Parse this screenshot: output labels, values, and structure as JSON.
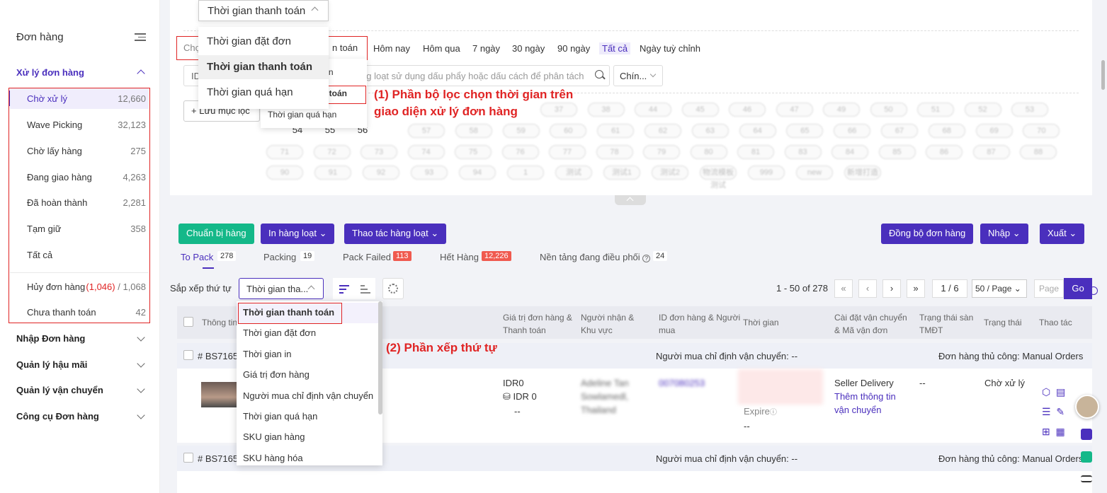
{
  "sidebar": {
    "title": "Đơn hàng",
    "sections": [
      {
        "label": "Xử lý đơn hàng"
      },
      {
        "label": "Nhập Đơn hàng"
      },
      {
        "label": "Quản lý hậu mãi"
      },
      {
        "label": "Quản lý vận chuyển"
      },
      {
        "label": "Công cụ Đơn hàng"
      }
    ],
    "items": [
      {
        "label": "Chờ xử lý",
        "count": "12,660"
      },
      {
        "label": "Wave Picking",
        "count": "32,123"
      },
      {
        "label": "Chờ lấy hàng",
        "count": "275"
      },
      {
        "label": "Đang giao hàng",
        "count": "4,263"
      },
      {
        "label": "Đã hoàn thành",
        "count": "2,281"
      },
      {
        "label": "Tạm giữ",
        "count": "358"
      },
      {
        "label": "Tất cả",
        "count": ""
      },
      {
        "label": "Hủy đơn hàng",
        "count_red": "(1,046)",
        "count": "/ 1,068"
      },
      {
        "label": "Chưa thanh toán",
        "count": "42"
      }
    ]
  },
  "filter": {
    "time_prefix": "Chọ",
    "time_value": "n toán",
    "quick": [
      "Hôm nay",
      "Hôm qua",
      "7 ngày",
      "30 ngày",
      "90 ngày",
      "Tất cả",
      "Ngày tuỳ chỉnh"
    ],
    "id_label": "ID",
    "id_placeholder": "ng loạt sử dụng dấu phẩy hoặc dấu cách để phân tách",
    "channel_select": "Chín...",
    "save_filter": "Lưu mục lọc",
    "chips_clear": [
      "54",
      "55",
      "56"
    ],
    "chips_row1": [
      "37",
      "38",
      "44",
      "45",
      "46",
      "47",
      "49",
      "50",
      "51",
      "52",
      "53"
    ],
    "chips_row2": [
      "57",
      "58",
      "59",
      "60",
      "61",
      "62",
      "63",
      "64",
      "65",
      "66",
      "67",
      "68",
      "69",
      "70"
    ],
    "chips_row3": [
      "71",
      "72",
      "73",
      "74",
      "75",
      "76",
      "77",
      "78",
      "79",
      "80",
      "81",
      "83",
      "84",
      "85",
      "86",
      "87",
      "88"
    ],
    "chips_row4": [
      "90",
      "91",
      "92",
      "93",
      "94",
      "1",
      "测试",
      "测试1",
      "测试2",
      "物流模板测试",
      "999",
      "new",
      "新增打造"
    ]
  },
  "time_dropdown": {
    "top_value": "Thời gian thanh toán",
    "options": [
      "Thời gian đặt đơn",
      "Thời gian thanh toán",
      "Thời gian quá hạn"
    ],
    "small_options": [
      "ơn",
      "n toán",
      "Thời gian quá hạn"
    ]
  },
  "annotations": {
    "one_line1": "(1) Phần bộ lọc chọn thời gian trên",
    "one_line2": "giao diện xử lý đơn hàng",
    "two": "(2) Phần xếp thứ tự"
  },
  "toolbar": {
    "prepare": "Chuẩn bị hàng",
    "print_bulk": "In hàng loạt",
    "bulk_actions": "Thao tác hàng loạt",
    "sync": "Đồng bộ đơn hàng",
    "import": "Nhập",
    "export": "Xuất"
  },
  "tabs": [
    {
      "label": "To Pack",
      "count": "278"
    },
    {
      "label": "Packing",
      "count": "19"
    },
    {
      "label": "Pack Failed",
      "count": "113"
    },
    {
      "label": "Hết Hàng",
      "count": "12,226"
    },
    {
      "label": "Nền tảng đang điều phối",
      "count": "24"
    }
  ],
  "sort": {
    "label": "Sắp xếp thứ tự",
    "value": "Thời gian tha...",
    "options": [
      "Thời gian thanh toán",
      "Thời gian đặt đơn",
      "Thời gian in",
      "Giá trị đơn hàng",
      "Người mua chỉ định vận chuyển",
      "Thời gian quá hạn",
      "SKU gian hàng",
      "SKU hàng hóa"
    ]
  },
  "pager": {
    "range": "1 - 50 of 278",
    "page": "1 / 6",
    "size": "50 / Page",
    "page_placeholder": "Page",
    "go": "Go"
  },
  "table": {
    "headers": {
      "info": "Thông tin",
      "value": "Giá trị đơn hàng & Thanh toán",
      "receiver": "Người nhận & Khu vực",
      "order_id": "ID đơn hàng & Người mua",
      "time": "Thời gian",
      "shipping": "Cài đặt vận chuyển & Mã vận đơn",
      "platform_status": "Trạng thái sàn TMĐT",
      "status": "Trạng thái",
      "actions": "Thao tác"
    },
    "rows": [
      {
        "order_no": "# BS7165",
        "buyer_shipping": "Người mua chỉ định vận chuyển: --",
        "manual": "Đơn hàng thủ công: Manual Orders",
        "value1": "IDR0",
        "value2": "IDR 0",
        "value3": "--",
        "receiver1": "Adeline Tan",
        "receiver2": "Sowlamedl,",
        "receiver3": "Thailand",
        "order_id": "007080253",
        "expire": "Expire",
        "time_dash": "--",
        "ship1": "Seller Delivery",
        "ship2": "Thêm thông tin",
        "ship3": "vận chuyển",
        "platform_status": "--",
        "status": "Chờ xử lý"
      },
      {
        "order_no": "# BS7165",
        "buyer_shipping": "Người mua chỉ định vận chuyển: --",
        "manual": "Đơn hàng thủ công: Manual Orders"
      }
    ]
  }
}
